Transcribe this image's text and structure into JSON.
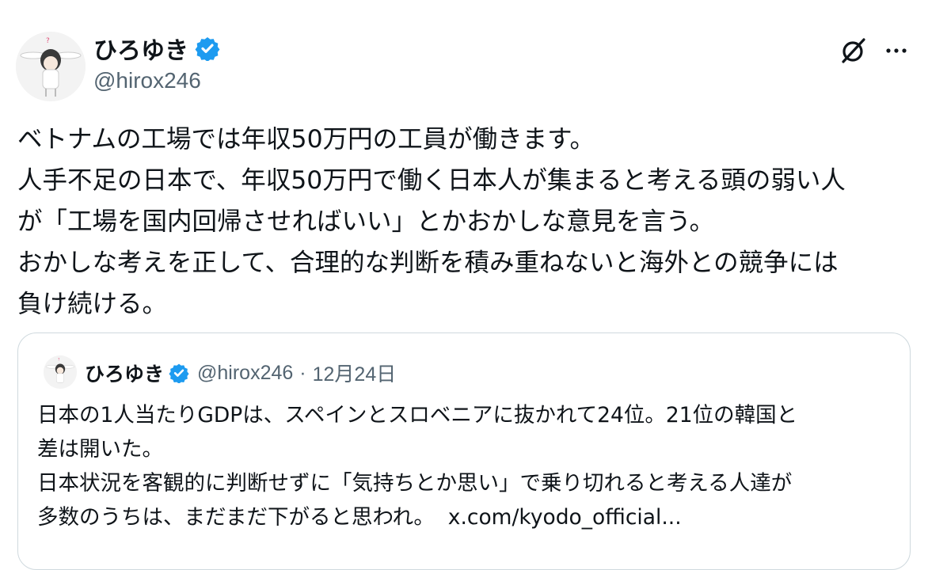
{
  "author": {
    "name": "ひろゆき",
    "handle": "@hirox246"
  },
  "post": {
    "lines": [
      "ベトナムの工場では年収50万円の工員が働きます。",
      "人手不足の日本で、年収50万円で働く日本人が集まると考える頭の弱い人",
      "が「工場を国内回帰させればいい」とかおかしな意見を言う。",
      "おかしな考えを正して、合理的な判断を積み重ねないと海外との競争には",
      "負け続ける。"
    ]
  },
  "quote": {
    "name": "ひろゆき",
    "handle": "@hirox246",
    "separator": "·",
    "date": "12月24日",
    "lines": [
      "日本の1人当たりGDPは、スペインとスロベニアに抜かれて24位。21位の韓国と",
      "差は開いた。",
      "日本状況を客観的に判断せずに「気持ちとか思い」で乗り切れると考える人達が",
      "多数のうちは、まだまだ下がると思われ。"
    ],
    "link": "x.com/kyodo_official..."
  },
  "icons": {
    "verified": "verified-badge-icon",
    "grok": "grok-icon",
    "more": "more-dots-icon"
  },
  "colors": {
    "verified": "#1d9bf0",
    "text": "#0f1419",
    "secondary": "#536471",
    "border": "#cfd9de"
  }
}
